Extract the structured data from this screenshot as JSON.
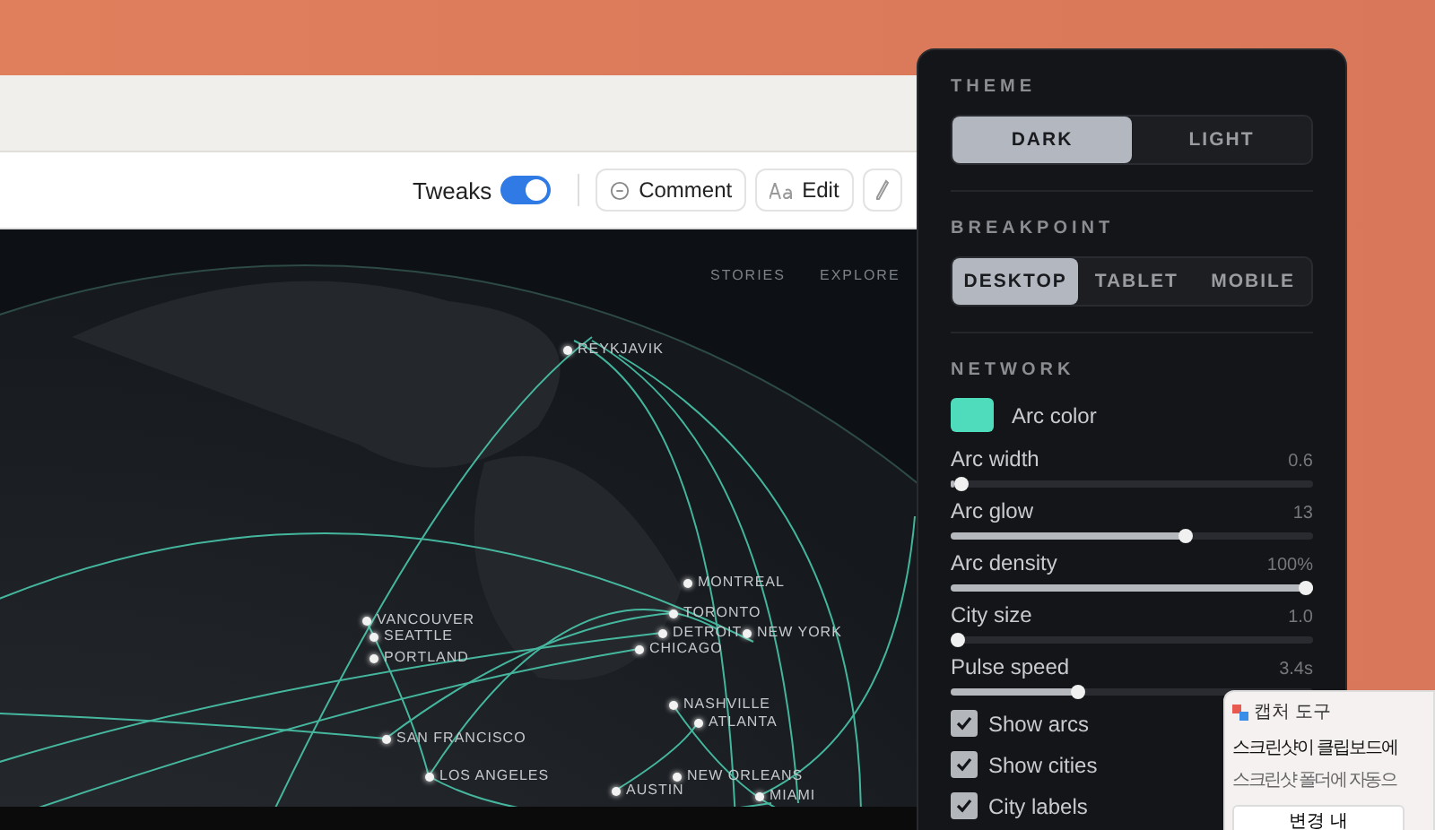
{
  "toolbar": {
    "tweaks": {
      "label": "Tweaks",
      "on": true
    },
    "buttons": [
      {
        "kind": "comment",
        "label": "Comment"
      },
      {
        "kind": "edit",
        "label": "Edit"
      },
      {
        "kind": "pencil"
      }
    ]
  },
  "map": {
    "nav": [
      "STORIES",
      "EXPLORE"
    ],
    "cities": [
      {
        "name": "REYKJAVIK"
      },
      {
        "name": "VANCOUVER"
      },
      {
        "name": "SEATTLE"
      },
      {
        "name": "PORTLAND"
      },
      {
        "name": "SAN FRANCISCO"
      },
      {
        "name": "LOS ANGELES"
      },
      {
        "name": "MONTREAL"
      },
      {
        "name": "TORONTO"
      },
      {
        "name": "DETROIT"
      },
      {
        "name": "NEW YORK"
      },
      {
        "name": "CHICAGO"
      },
      {
        "name": "NASHVILLE"
      },
      {
        "name": "ATLANTA"
      },
      {
        "name": "NEW ORLEANS"
      },
      {
        "name": "AUSTIN"
      },
      {
        "name": "MIAMI"
      }
    ]
  },
  "panel": {
    "sections": [
      {
        "kind": "segmented",
        "title": "THEME",
        "options": [
          {
            "label": "DARK",
            "selected": true
          },
          {
            "label": "LIGHT",
            "selected": false
          }
        ]
      },
      {
        "kind": "segmented",
        "title": "BREAKPOINT",
        "options": [
          {
            "label": "DESKTOP",
            "selected": true
          },
          {
            "label": "TABLET",
            "selected": false
          },
          {
            "label": "MOBILE",
            "selected": false
          }
        ]
      },
      {
        "kind": "controls",
        "title": "NETWORK",
        "items": [
          {
            "kind": "color",
            "label": "Arc color",
            "color": "#4fdcbc"
          },
          {
            "kind": "slider",
            "label": "Arc width",
            "reading": "0.6",
            "level": 0.01
          },
          {
            "kind": "slider",
            "label": "Arc glow",
            "reading": "13",
            "level": 0.65
          },
          {
            "kind": "slider",
            "label": "Arc density",
            "reading": "100%",
            "level": 1
          },
          {
            "kind": "slider",
            "label": "City size",
            "reading": "1.0",
            "level": 0
          },
          {
            "kind": "slider",
            "label": "Pulse speed",
            "reading": "3.4s",
            "level": 0.35
          },
          {
            "kind": "checkbox",
            "label": "Show arcs",
            "checked": true
          },
          {
            "kind": "checkbox",
            "label": "Show cities",
            "checked": true
          },
          {
            "kind": "checkbox",
            "label": "City labels",
            "checked": true
          }
        ]
      }
    ]
  },
  "toast": {
    "app": "캡처 도구",
    "title": "스크린샷이 클립보드에",
    "body": "스크린샷 폴더에 자동으",
    "button": "변경 내"
  }
}
